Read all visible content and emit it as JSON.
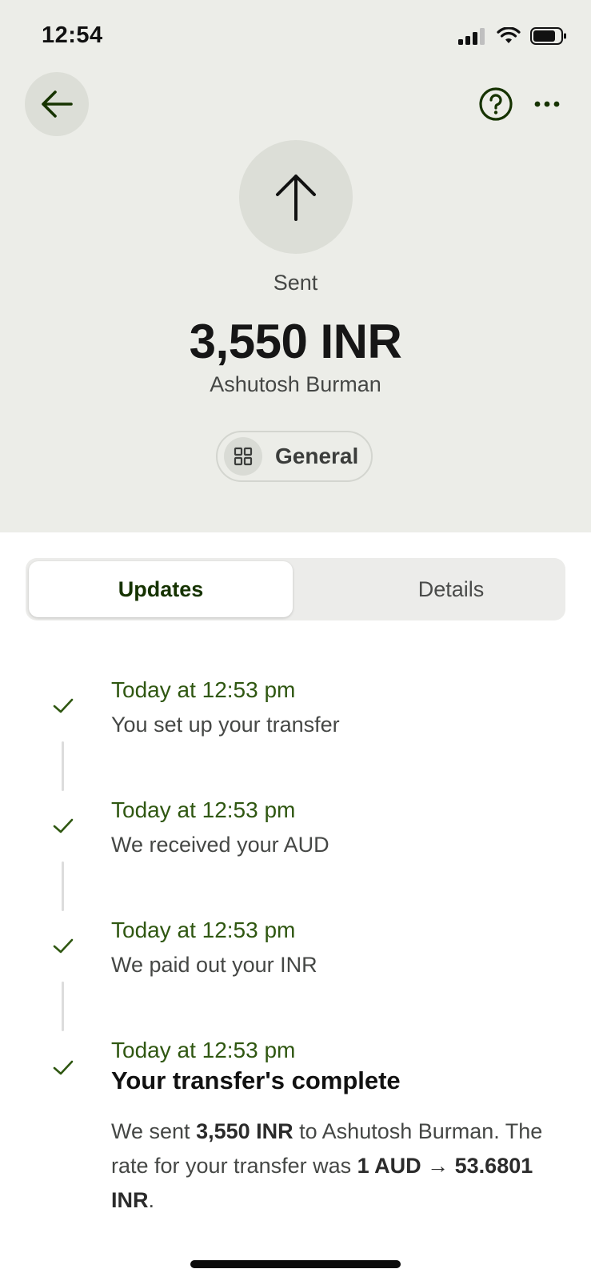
{
  "status_bar": {
    "time": "12:54"
  },
  "header": {
    "direction_label": "Sent",
    "amount": "3,550 INR",
    "recipient": "Ashutosh Burman",
    "category": "General"
  },
  "tabs": [
    {
      "label": "Updates",
      "active": true
    },
    {
      "label": "Details",
      "active": false
    }
  ],
  "updates": [
    {
      "time": "Today at 12:53 pm",
      "text": "You set up your transfer"
    },
    {
      "time": "Today at 12:53 pm",
      "text": "We received your AUD"
    },
    {
      "time": "Today at 12:53 pm",
      "text": "We paid out your INR"
    },
    {
      "time": "Today at 12:53 pm",
      "title": "Your transfer's complete",
      "body": {
        "p1": "We sent ",
        "amount": "3,550 INR",
        "p2": " to Ashutosh Burman. The rate for your transfer was ",
        "rate": "1 AUD → 53.6801 INR",
        "p3": "."
      }
    }
  ],
  "colors": {
    "accent_green": "#163300",
    "timestamp_green": "#2f5711",
    "header_bg": "#ecede8"
  },
  "icons": [
    "back-arrow-icon",
    "help-icon",
    "more-icon",
    "sent-arrow-icon",
    "category-grid-icon",
    "check-icon"
  ]
}
